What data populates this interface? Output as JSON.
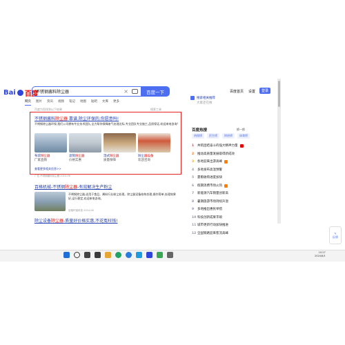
{
  "header": {
    "logo_bai": "Bai",
    "logo_du": "百度",
    "search_value": "不锈钢酱料除尘器",
    "search_button": "百度一下",
    "links": [
      "百度首页",
      "设置"
    ],
    "login": "登录"
  },
  "tabs": [
    "网页",
    "图片",
    "资讯",
    "视频",
    "笔记",
    "地图",
    "贴吧",
    "文库",
    "更多"
  ],
  "result_count": "百度为您找到以下结果",
  "search_tools": "搜索工具",
  "ad": {
    "title_prefix": "不锈钢酱料",
    "title_red": "除尘器",
    "title_suffix": " 靠谱,除尘环保的,你愿意吗!",
    "desc": "不锈钢除尘器环保,我们公司拥有专业技术团队,全力帮你保障废气处理达标,专业团队专业施工,品质保证,欢迎来电咨询!",
    "items": [
      {
        "line1_a": "布袋",
        "line1_b": "除尘器",
        "line2": "厂家直销"
      },
      {
        "line1_a": "滤筒",
        "line1_b": "除尘器",
        "line2": "价格实惠"
      },
      {
        "line1_a": "湿式",
        "line1_b": "除尘器",
        "line2": "质量保障"
      },
      {
        "line1_a": "除尘",
        "line1_b": "器设备",
        "line2": "欢迎咨询"
      }
    ],
    "footer": "查看更多相关信息>>",
    "meta": "广告 不锈钢酱料除尘器 2024-06"
  },
  "result2": {
    "title_prefix": "百格机械-不锈钢",
    "title_red": "除尘器",
    "title_suffix": "-有效解决生产粉尘",
    "desc": "不锈钢除尘器,适用于食品、酱料行业粉尘处理。除尘器设备结构合理,操作简单,处理效果好,运行稳定,欢迎来电咨询。",
    "meta": "百格环保科技 2024-06"
  },
  "result3": {
    "title_prefix": "除尘设备",
    "title_red": "除尘器",
    "title_suffix": "-质量好价格实惠,不花冤枉钱!"
  },
  "sidebar": {
    "keyword_link": "搜索相关推荐",
    "keyword_sub": "大家还在搜",
    "hot_title": "百度热搜",
    "refresh": "换一换",
    "chips": [
      "热搜榜",
      "民生榜",
      "财经榜",
      "体育榜"
    ],
    "hot": [
      "共筑团结奋斗的强大精神力量",
      "推动高质量发展取得新成效",
      "各地迎来出游高峰",
      "多地发布高温预警",
      "夏粮收购进度加快",
      "假期消费市场火热",
      "新能源汽车销量创新高",
      "暑期旅游市场持续升温",
      "多地推出惠民举措",
      "科技创新成果丰硕",
      "城市更新行动加快推进",
      "全国铁路迎来客流高峰"
    ],
    "hot_tags": [
      "#e10602",
      "",
      "#ff7f00",
      "",
      "",
      "#ff7f00",
      "",
      "",
      "",
      "",
      "",
      ""
    ]
  },
  "side_button": "反馈",
  "taskbar": {
    "time": "10:27",
    "date": "2024/6/1"
  }
}
